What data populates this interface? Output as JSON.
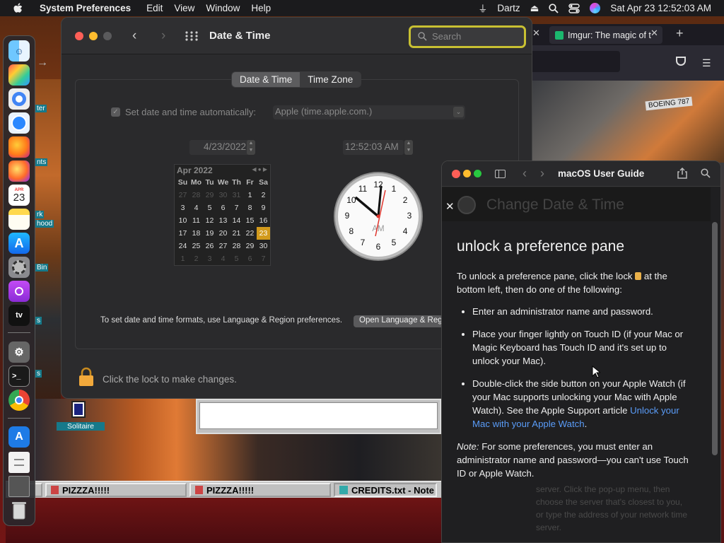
{
  "menubar": {
    "app_name": "System Preferences",
    "items": [
      "Edit",
      "View",
      "Window",
      "Help"
    ],
    "user": "Dartz",
    "datetime": "Sat Apr 23  12:52:03 AM"
  },
  "sysprefs": {
    "title": "Date & Time",
    "search_placeholder": "Search",
    "tabs": [
      "Date & Time",
      "Time Zone"
    ],
    "auto_label": "Set date and time automatically:",
    "server": "Apple (time.apple.com.)",
    "date_value": "4/23/2022",
    "time_value": "12:52:03 AM",
    "calendar": {
      "month": "Apr 2022",
      "weekdays": [
        "Su",
        "Mo",
        "Tu",
        "We",
        "Th",
        "Fr",
        "Sa"
      ],
      "days": [
        "27",
        "28",
        "29",
        "30",
        "31",
        "1",
        "2",
        "3",
        "4",
        "5",
        "6",
        "7",
        "8",
        "9",
        "10",
        "11",
        "12",
        "13",
        "14",
        "15",
        "16",
        "17",
        "18",
        "19",
        "20",
        "21",
        "22",
        "23",
        "24",
        "25",
        "26",
        "27",
        "28",
        "29",
        "30",
        "1",
        "2",
        "3",
        "4",
        "5",
        "6",
        "7"
      ],
      "selected": "23"
    },
    "clock_label": "AM",
    "clock_numbers": [
      "12",
      "1",
      "2",
      "3",
      "4",
      "5",
      "6",
      "7",
      "8",
      "9",
      "10",
      "11"
    ],
    "formats_text": "To set date and time formats, use Language & Region preferences.",
    "open_button": "Open Language & Regi",
    "lock_text": "Click the lock to make changes."
  },
  "browser": {
    "tab_label": "Imgur: The magic of t"
  },
  "guide": {
    "title": "macOS User Guide",
    "faded_heading": "Change Date & Time",
    "heading": "unlock a preference pane",
    "intro_a": "To unlock a preference pane, click the lock",
    "intro_b": "at the bottom left, then do one of the following:",
    "bullet1": "Enter an administrator name and password.",
    "bullet2": "Place your finger lightly on Touch ID (if your Mac or Magic Keyboard has Touch ID and it's set up to unlock your Mac).",
    "bullet3_text": "Double-click the side button on your Apple Watch (if your Mac supports unlocking your Mac with Apple Watch). See the Apple Support article",
    "bullet3_link": "Unlock your Mac with your Apple Watch",
    "note_label": "Note:",
    "note_text": "For some preferences, you must enter an administrator name and password—you can't use Touch ID or Apple Watch.",
    "faded_tail": "server. Click the pop-up menu, then choose the server that's closest to you, or type the address of your network time server."
  },
  "desktop": {
    "solitaire_label": "Solitaire",
    "side_labels": [
      "ter",
      "nts",
      "rk",
      "hood",
      "Bin",
      "s",
      "s"
    ],
    "boeing_sign": "BOEING 787",
    "calendar_month": "APR",
    "calendar_day": "23"
  },
  "taskbar": {
    "items": [
      "PIZZZA!!!!!",
      "PIZZZA!!!!!",
      "CREDITS.txt - Note"
    ],
    "start_fragment": "t"
  }
}
